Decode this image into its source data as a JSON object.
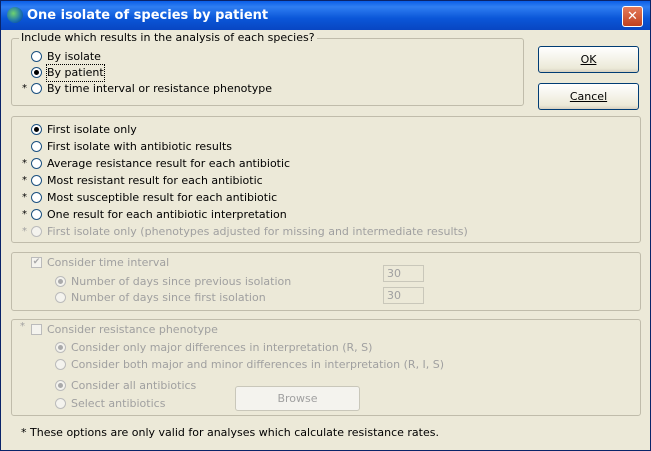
{
  "window": {
    "title": "One isolate of species by patient",
    "close_glyph": "✕"
  },
  "buttons": {
    "ok": "OK",
    "cancel": "Cancel",
    "browse": "Browse"
  },
  "include_group": {
    "legend": "Include which results in the analysis of each species?",
    "options": [
      {
        "label": "By isolate",
        "selected": false,
        "starred": false
      },
      {
        "label": "By patient",
        "selected": true,
        "starred": false
      },
      {
        "label": "By time interval or resistance phenotype",
        "selected": false,
        "starred": true
      }
    ]
  },
  "method_group": {
    "options": [
      {
        "label": "First isolate only",
        "selected": true,
        "starred": false,
        "enabled": true
      },
      {
        "label": "First isolate with antibiotic results",
        "selected": false,
        "starred": false,
        "enabled": true
      },
      {
        "label": "Average resistance result for each antibiotic",
        "selected": false,
        "starred": true,
        "enabled": true
      },
      {
        "label": "Most resistant result for each antibiotic",
        "selected": false,
        "starred": true,
        "enabled": true
      },
      {
        "label": "Most susceptible result for each antibiotic",
        "selected": false,
        "starred": true,
        "enabled": true
      },
      {
        "label": "One result for each antibiotic interpretation",
        "selected": false,
        "starred": true,
        "enabled": true
      },
      {
        "label": "First isolate only (phenotypes adjusted for missing and intermediate results)",
        "selected": false,
        "starred": true,
        "enabled": false
      }
    ]
  },
  "time_group": {
    "checkbox_label": "Consider time interval",
    "checked": true,
    "options": [
      {
        "label": "Number of days since previous isolation",
        "selected": true,
        "value": "30"
      },
      {
        "label": "Number of days since first isolation",
        "selected": false,
        "value": "30"
      }
    ]
  },
  "phenotype_group": {
    "checkbox_label": "Consider resistance phenotype",
    "checked": false,
    "difference_options": [
      {
        "label": "Consider only major differences in interpretation (R, S)",
        "selected": true
      },
      {
        "label": "Consider both major and minor differences in interpretation (R, I, S)",
        "selected": false
      }
    ],
    "antibiotic_options": [
      {
        "label": "Consider all antibiotics",
        "selected": true
      },
      {
        "label": "Select antibiotics",
        "selected": false
      }
    ]
  },
  "footnote": "* These options are only valid for analyses which calculate resistance rates.",
  "star": "*"
}
